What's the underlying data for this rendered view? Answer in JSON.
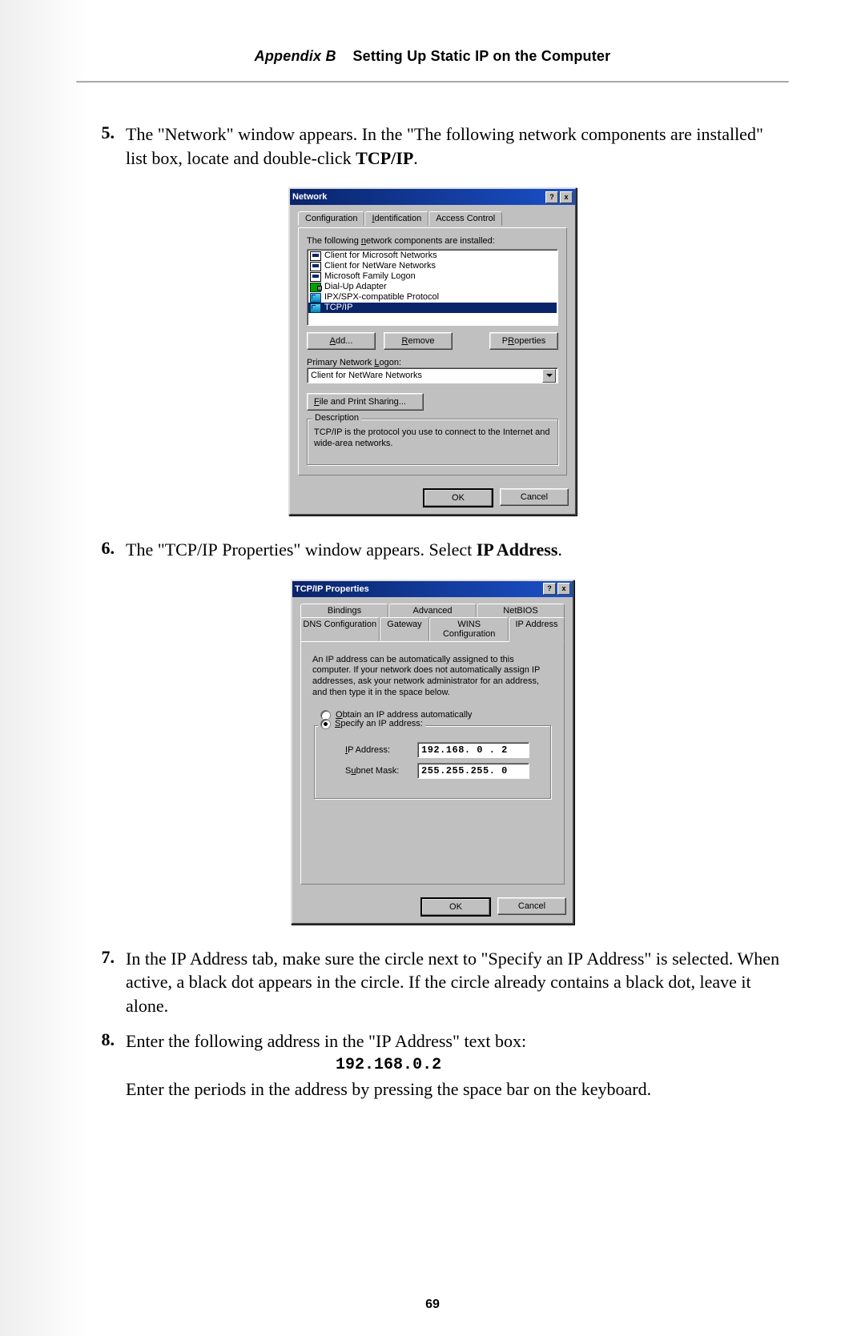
{
  "header": {
    "appendix": "Appendix B",
    "title": "Setting Up Static IP on the Computer"
  },
  "page_number": "69",
  "steps": {
    "s5": {
      "num": "5.",
      "t1": "The \"Network\" window appears. In the \"The following network components are installed\" list box, locate and double-click ",
      "bold": "TCP/IP",
      "t2": "."
    },
    "s6": {
      "num": "6.",
      "t1": "The \"",
      "sc1": "TCP/IP",
      "t2": " Properties\" window appears. Select ",
      "bold": "IP Address",
      "t3": "."
    },
    "s7": {
      "num": "7.",
      "t1": "In the ",
      "sc1": "IP",
      "t2": " Address tab, make sure the circle next to \"Specify an ",
      "sc2": "IP",
      "t3": " Address\" is selected. When active, a black dot appears in the circle. If the circle already contains a black dot, leave it alone."
    },
    "s8": {
      "num": "8.",
      "t1": "Enter the following address in the \"",
      "sc1": "IP",
      "t2": " Address\" text box:",
      "ip": "192.168.0.2",
      "t3": "Enter the periods in the address by pressing the space bar on the keyboard."
    }
  },
  "dlg1": {
    "title": "Network",
    "help": "?",
    "close": "x",
    "tabs": {
      "config": "Configuration",
      "ident": "Identification",
      "access": "Access Control"
    },
    "list_label": "The following network components are installed:",
    "items": [
      "Client for Microsoft Networks",
      "Client for NetWare Networks",
      "Microsoft Family Logon",
      "Dial-Up Adapter",
      "IPX/SPX-compatible Protocol",
      "TCP/IP"
    ],
    "btn_add": "Add...",
    "btn_remove": "Remove",
    "btn_props": "Properties",
    "logon_label": "Primary Network Logon:",
    "logon_value": "Client for NetWare Networks",
    "fps": "File and Print Sharing...",
    "desc_legend": "Description",
    "desc_text": "TCP/IP is the protocol you use to connect to the Internet and wide-area networks.",
    "ok": "OK",
    "cancel": "Cancel",
    "u": {
      "n": "n",
      "I": "I",
      "A": "A",
      "R": "R",
      "o": "o",
      "L": "L",
      "F": "F"
    }
  },
  "dlg2": {
    "title": "TCP/IP Properties",
    "help": "?",
    "close": "x",
    "tabs_top": {
      "bind": "Bindings",
      "adv": "Advanced",
      "netbios": "NetBIOS"
    },
    "tabs_bot": {
      "dns": "DNS Configuration",
      "gw": "Gateway",
      "wins": "WINS Configuration",
      "ip": "IP Address"
    },
    "note": "An IP address can be automatically assigned to this computer. If your network does not automatically assign IP addresses, ask your network administrator for an address, and then type it in the space below.",
    "r_auto_pre": "O",
    "r_auto": "btain an IP address automatically",
    "r_spec_pre": "S",
    "r_spec": "pecify an IP address:",
    "ip_label_pre": "I",
    "ip_label": "P Address:",
    "mask_label_pre": "S",
    "mask_label": "ubnet Mask:",
    "ip_value": "192.168. 0 . 2",
    "mask_value": "255.255.255. 0",
    "ok": "OK",
    "cancel": "Cancel"
  }
}
